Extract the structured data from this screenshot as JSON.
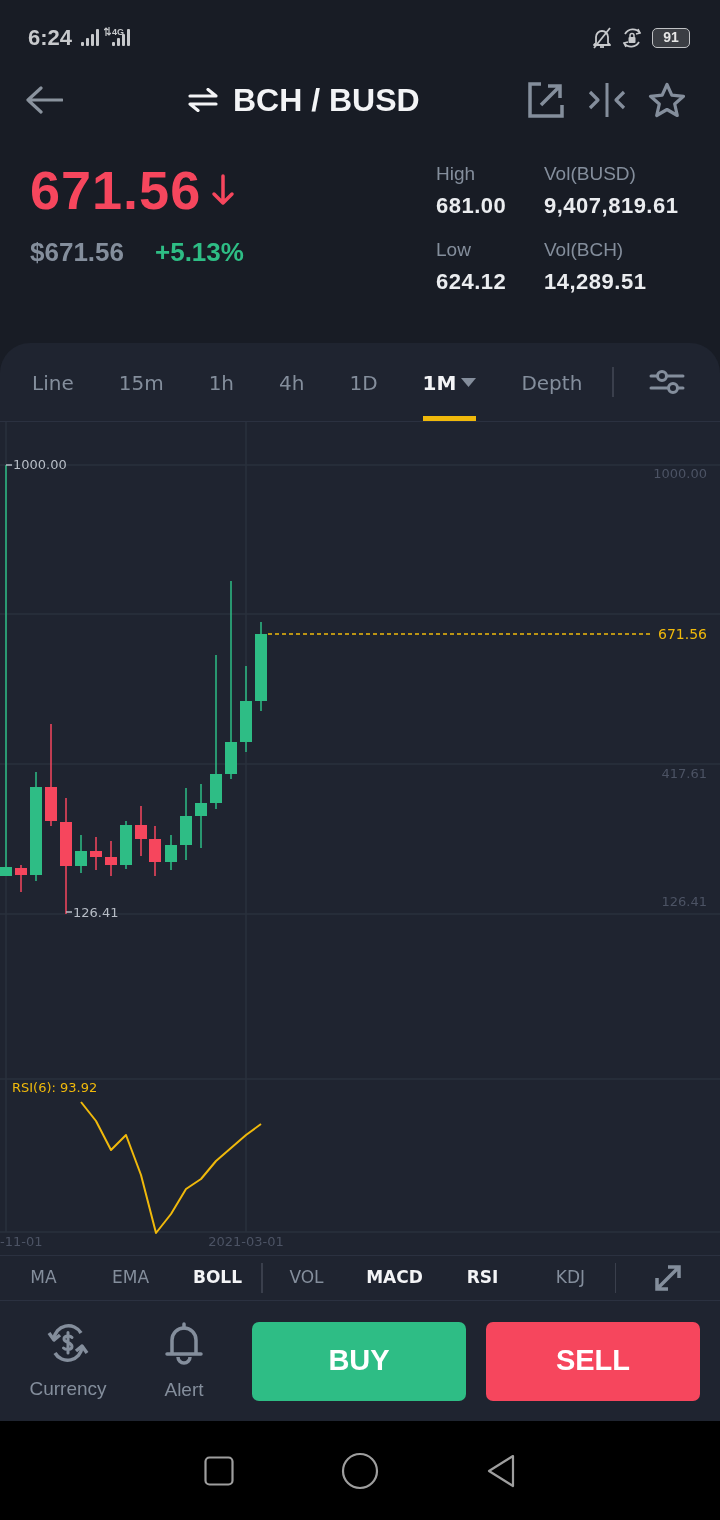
{
  "status_bar": {
    "time": "6:24",
    "network": "4G",
    "battery": "91"
  },
  "header": {
    "title": "BCH / BUSD"
  },
  "price": {
    "last": "671.56",
    "falling": true,
    "fiat": "$671.56",
    "change": "+5.13%",
    "change_positive": true
  },
  "stats": [
    {
      "label": "High",
      "value": "681.00"
    },
    {
      "label": "Vol(BUSD)",
      "value": "9,407,819.61"
    },
    {
      "label": "Low",
      "value": "624.12"
    },
    {
      "label": "Vol(BCH)",
      "value": "14,289.51"
    }
  ],
  "intervals": [
    {
      "label": "Line",
      "selected": false,
      "dropdown": false
    },
    {
      "label": "15m",
      "selected": false,
      "dropdown": false
    },
    {
      "label": "1h",
      "selected": false,
      "dropdown": false
    },
    {
      "label": "4h",
      "selected": false,
      "dropdown": false
    },
    {
      "label": "1D",
      "selected": false,
      "dropdown": false
    },
    {
      "label": "1M",
      "selected": true,
      "dropdown": true
    },
    {
      "label": "Depth",
      "selected": false,
      "dropdown": false
    }
  ],
  "chart": {
    "y_axis": [
      "1000.00",
      "417.61",
      "126.41"
    ],
    "high_label": "1000.00",
    "low_label": "126.41",
    "last_price": "671.56",
    "x_axis": [
      "-11-01",
      "2021-03-01"
    ],
    "rsi_label": "RSI(6): 93.92"
  },
  "main_indicators": [
    {
      "label": "MA",
      "selected": false
    },
    {
      "label": "EMA",
      "selected": false
    },
    {
      "label": "BOLL",
      "selected": true
    }
  ],
  "sub_indicators": [
    {
      "label": "VOL",
      "selected": false
    },
    {
      "label": "MACD",
      "selected": true
    },
    {
      "label": "RSI",
      "selected": true
    },
    {
      "label": "KDJ",
      "selected": false
    }
  ],
  "actions": [
    {
      "label": "Currency",
      "kind": "currency"
    },
    {
      "label": "Alert",
      "kind": "alert"
    }
  ],
  "trade_buttons": [
    {
      "label": "BUY",
      "kind": "buy"
    },
    {
      "label": "SELL",
      "kind": "sell"
    }
  ]
}
